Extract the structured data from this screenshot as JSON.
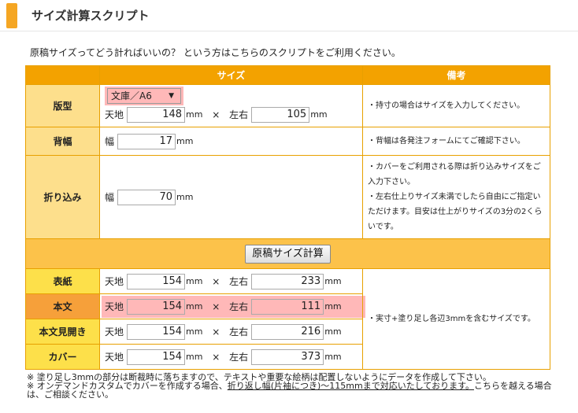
{
  "header": {
    "title": "サイズ計算スクリプト"
  },
  "intro": "原稿サイズってどう計ればいいの？ という方はこちらのスクリプトをご利用ください。",
  "table": {
    "col_size": "サイズ",
    "col_notes": "備考",
    "hanhata": {
      "label": "版型",
      "select_value": "文庫／A6",
      "tenchi_label": "天地",
      "tenchi_value": "148",
      "sayu_label": "左右",
      "sayu_value": "105",
      "unit": "mm",
      "times": "×",
      "note": "・持寸の場合はサイズを入力してください。"
    },
    "sehaba": {
      "label": "背幅",
      "haba_label": "幅",
      "value": "17",
      "unit": "mm",
      "note": "・背幅は各発注フォームにてご確認下さい。"
    },
    "orikomi": {
      "label": "折り込み",
      "haba_label": "幅",
      "value": "70",
      "unit": "mm",
      "note_lines": [
        "・カバーをご利用される際は折り込みサイズをご",
        "入力下さい。",
        "・左右仕上りサイズ未満でしたら自由にご指定い",
        "ただけます。目安は仕上がりサイズの3分の2くら",
        "いです。"
      ]
    },
    "calc_button": "原稿サイズ計算",
    "results": [
      {
        "label": "表紙",
        "tenchi": "154",
        "sayu": "233"
      },
      {
        "label": "本文",
        "tenchi": "154",
        "sayu": "111"
      },
      {
        "label": "本文見開き",
        "tenchi": "154",
        "sayu": "216"
      },
      {
        "label": "カバー",
        "tenchi": "154",
        "sayu": "373"
      }
    ],
    "results_tenchi_label": "天地",
    "results_sayu_label": "左右",
    "results_unit": "mm",
    "results_times": "×",
    "results_note": "・実寸+塗り足し各辺3mmを含むサイズです。"
  },
  "footnotes": {
    "line1": "※ 塗り足し3mmの部分は断裁時に落ちますので、テキストや重要な絵柄は配置しないようにデータを作成して下さい。",
    "line2_a": "※ オンデマンドカスタムでカバーを作成する場合、",
    "line2_u": "折り返し幅(片袖につき)〜115mmまで対応いたしております。",
    "line2_b": "こちらを越える場合",
    "line3": "は、ご相談ください。"
  },
  "colors": {
    "accent": "#f3a200",
    "label_bg": "#fddf8c",
    "result_label_bg": "#fde04a",
    "highlight": "#ffb8b8"
  }
}
